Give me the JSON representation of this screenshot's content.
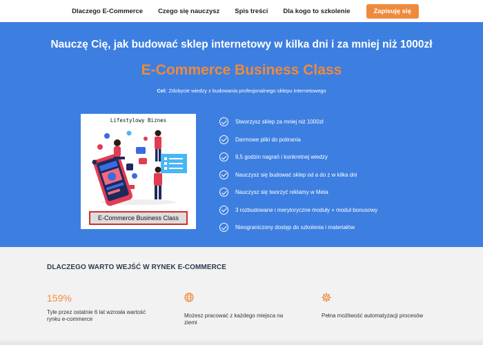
{
  "nav": {
    "items": [
      "Dlaczego E-Commerce",
      "Czego się nauczysz",
      "Spis treści",
      "Dla kogo to szkolenie"
    ],
    "cta": "Zapisuję się"
  },
  "hero": {
    "title": "Nauczę Cię, jak budować sklep internetowy w kilka dni i za mniej niż 1000zł",
    "product": "E-Commerce Business Class",
    "goal_label": "Cel:",
    "goal_text": "Zdobycie wiedzy z budowania profesjonalnego sklepu internetowego",
    "image": {
      "caption_top": "Lifestylowy Biznes",
      "caption_box": "E-Commerce Business Class"
    },
    "features": [
      "Stworzysz sklep za mniej niż 1000zł",
      "Darmowe pliki do pobrania",
      "9,5 godzin nagrań i konkretnej wiedzy",
      "Nauczysz się budować sklep od a do z w kilka dni",
      "Nauczysz się tworzyć reklamy w Meta",
      "3 rozbudowane i merytoryczne moduły + moduł bonusowy",
      "Nieograniczony dostęp do szkolenia i materiałów"
    ]
  },
  "why": {
    "title": "DLACZEGO WARTO WEJŚĆ W RYNEK E-COMMERCE",
    "columns": [
      {
        "stat": "159%",
        "text": "Tyle przez ostatnie 6 lat wzrosła wartość rynku e-commerce"
      },
      {
        "icon": "globe-icon",
        "text": "Możesz pracować z każdego miejsca na ziemi"
      },
      {
        "icon": "gear-icon",
        "text": "Pełna możliwość automatyzacji procesów"
      }
    ]
  },
  "colors": {
    "accent": "#ef8a3c",
    "hero_bg": "#3d7fe0",
    "section_bg": "#f2f2f2"
  }
}
